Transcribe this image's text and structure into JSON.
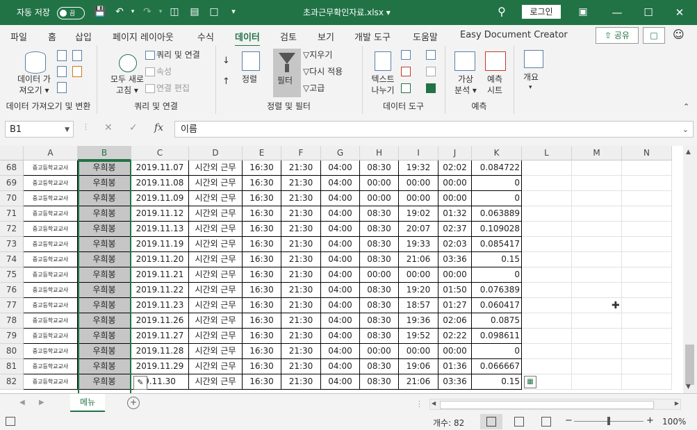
{
  "titlebar": {
    "autosave_label": "자동 저장",
    "autosave_state": "끔",
    "filename": "초과근무확인자료.xlsx ▾",
    "login_label": "로그인"
  },
  "tabs": [
    "파일",
    "홈",
    "삽입",
    "페이지 레이아웃",
    "수식",
    "데이터",
    "검토",
    "보기",
    "개발 도구",
    "도움말",
    "Easy Document Creator"
  ],
  "active_tab": "데이터",
  "share_label": "공유",
  "ribbon": {
    "get_data": "데이터 가\n져오기 ▾",
    "group1_label": "데이터 가져오기 및 변환",
    "refresh_all": "모두 새로\n고침 ▾",
    "queries_connections": "쿼리 및 연결",
    "properties": "속성",
    "edit_links": "연결 편집",
    "group2_label": "쿼리 및 연결",
    "sort": "정렬",
    "filter": "필터",
    "clear": "지우기",
    "reapply": "다시 적용",
    "advanced": "고급",
    "group3_label": "정렬 및 필터",
    "text_to_columns": "텍스트\n나누기",
    "group4_label": "데이터 도구",
    "what_if": "가상\n분석 ▾",
    "forecast_sheet": "예측\n시트",
    "group5_label": "예측",
    "outline": "개요"
  },
  "formula_bar": {
    "name_box": "B1",
    "formula": "이름"
  },
  "columns": [
    "A",
    "B",
    "C",
    "D",
    "E",
    "F",
    "G",
    "H",
    "I",
    "J",
    "K",
    "L",
    "M",
    "N"
  ],
  "selected_column": "B",
  "rows": [
    {
      "n": "68",
      "a": "중고등학교교사",
      "b": "우희봉",
      "c": "2019.11.07",
      "d": "시간외 근무",
      "e": "16:30",
      "f": "21:30",
      "g": "04:00",
      "h": "08:30",
      "i": "19:32",
      "j": "02:02",
      "k": "0.084722"
    },
    {
      "n": "69",
      "a": "중고등학교교사",
      "b": "우희봉",
      "c": "2019.11.08",
      "d": "시간외 근무",
      "e": "16:30",
      "f": "21:30",
      "g": "04:00",
      "h": "00:00",
      "i": "00:00",
      "j": "00:00",
      "k": "0"
    },
    {
      "n": "70",
      "a": "중고등학교교사",
      "b": "우희봉",
      "c": "2019.11.09",
      "d": "시간외 근무",
      "e": "16:30",
      "f": "21:30",
      "g": "04:00",
      "h": "00:00",
      "i": "00:00",
      "j": "00:00",
      "k": "0"
    },
    {
      "n": "71",
      "a": "중고등학교교사",
      "b": "우희봉",
      "c": "2019.11.12",
      "d": "시간외 근무",
      "e": "16:30",
      "f": "21:30",
      "g": "04:00",
      "h": "08:30",
      "i": "19:02",
      "j": "01:32",
      "k": "0.063889"
    },
    {
      "n": "72",
      "a": "중고등학교교사",
      "b": "우희봉",
      "c": "2019.11.13",
      "d": "시간외 근무",
      "e": "16:30",
      "f": "21:30",
      "g": "04:00",
      "h": "08:30",
      "i": "20:07",
      "j": "02:37",
      "k": "0.109028"
    },
    {
      "n": "73",
      "a": "중고등학교교사",
      "b": "우희봉",
      "c": "2019.11.19",
      "d": "시간외 근무",
      "e": "16:30",
      "f": "21:30",
      "g": "04:00",
      "h": "08:30",
      "i": "19:33",
      "j": "02:03",
      "k": "0.085417"
    },
    {
      "n": "74",
      "a": "중고등학교교사",
      "b": "우희봉",
      "c": "2019.11.20",
      "d": "시간외 근무",
      "e": "16:30",
      "f": "21:30",
      "g": "04:00",
      "h": "08:30",
      "i": "21:06",
      "j": "03:36",
      "k": "0.15"
    },
    {
      "n": "75",
      "a": "중고등학교교사",
      "b": "우희봉",
      "c": "2019.11.21",
      "d": "시간외 근무",
      "e": "16:30",
      "f": "21:30",
      "g": "04:00",
      "h": "00:00",
      "i": "00:00",
      "j": "00:00",
      "k": "0"
    },
    {
      "n": "76",
      "a": "중고등학교교사",
      "b": "우희봉",
      "c": "2019.11.22",
      "d": "시간외 근무",
      "e": "16:30",
      "f": "21:30",
      "g": "04:00",
      "h": "08:30",
      "i": "19:20",
      "j": "01:50",
      "k": "0.076389"
    },
    {
      "n": "77",
      "a": "중고등학교교사",
      "b": "우희봉",
      "c": "2019.11.23",
      "d": "시간외 근무",
      "e": "16:30",
      "f": "21:30",
      "g": "04:00",
      "h": "08:30",
      "i": "18:57",
      "j": "01:27",
      "k": "0.060417"
    },
    {
      "n": "78",
      "a": "중고등학교교사",
      "b": "우희봉",
      "c": "2019.11.26",
      "d": "시간외 근무",
      "e": "16:30",
      "f": "21:30",
      "g": "04:00",
      "h": "08:30",
      "i": "19:36",
      "j": "02:06",
      "k": "0.0875"
    },
    {
      "n": "79",
      "a": "중고등학교교사",
      "b": "우희봉",
      "c": "2019.11.27",
      "d": "시간외 근무",
      "e": "16:30",
      "f": "21:30",
      "g": "04:00",
      "h": "08:30",
      "i": "19:52",
      "j": "02:22",
      "k": "0.098611"
    },
    {
      "n": "80",
      "a": "중고등학교교사",
      "b": "우희봉",
      "c": "2019.11.28",
      "d": "시간외 근무",
      "e": "16:30",
      "f": "21:30",
      "g": "04:00",
      "h": "00:00",
      "i": "00:00",
      "j": "00:00",
      "k": "0"
    },
    {
      "n": "81",
      "a": "중고등학교교사",
      "b": "우희봉",
      "c": "2019.11.29",
      "d": "시간외 근무",
      "e": "16:30",
      "f": "21:30",
      "g": "04:00",
      "h": "08:30",
      "i": "19:06",
      "j": "01:36",
      "k": "0.066667"
    },
    {
      "n": "82",
      "a": "중고등학교교사",
      "b": "우희봉",
      "c": "9.11.30",
      "d": "시간외 근무",
      "e": "16:30",
      "f": "21:30",
      "g": "04:00",
      "h": "08:30",
      "i": "21:06",
      "j": "03:36",
      "k": "0.15"
    }
  ],
  "sheet_tab": "메뉴",
  "status": {
    "count": "개수: 82",
    "zoom": "100%",
    "zoom_percent": 100
  }
}
